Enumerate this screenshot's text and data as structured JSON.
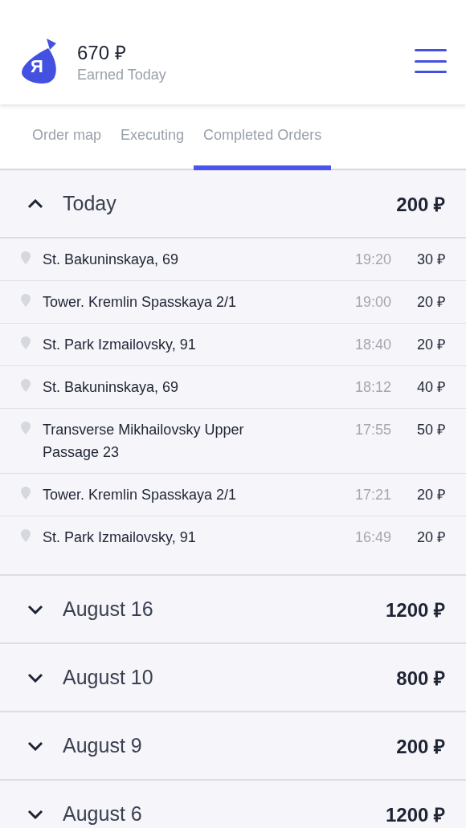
{
  "header": {
    "logo_letter": "Я",
    "amount": "670 ₽",
    "caption": "Earned Today"
  },
  "tabs": [
    {
      "label": "Order map",
      "selected": false
    },
    {
      "label": "Executing",
      "selected": false
    },
    {
      "label": "Completed Orders",
      "selected": true
    }
  ],
  "groups": [
    {
      "title": "Today",
      "total": "200 ₽",
      "expanded": true,
      "orders": [
        {
          "address": "St. Bakuninskaya, 69",
          "time": "19:20",
          "price": "30 ₽"
        },
        {
          "address": "Tower. Kremlin Spasskaya 2/1",
          "time": "19:00",
          "price": "20 ₽"
        },
        {
          "address": "St. Park Izmailovsky, 91",
          "time": "18:40",
          "price": "20 ₽"
        },
        {
          "address": "St. Bakuninskaya, 69",
          "time": "18:12",
          "price": "40 ₽"
        },
        {
          "address": "Transverse Mikhailovsky Upper Passage 23",
          "time": "17:55",
          "price": "50 ₽"
        },
        {
          "address": "Tower. Kremlin Spasskaya 2/1",
          "time": "17:21",
          "price": "20 ₽"
        },
        {
          "address": "St. Park Izmailovsky, 91",
          "time": "16:49",
          "price": "20 ₽"
        }
      ]
    },
    {
      "title": "August 16",
      "total": "1200 ₽",
      "expanded": false
    },
    {
      "title": "August 10",
      "total": "800 ₽",
      "expanded": false
    },
    {
      "title": "August 9",
      "total": "200 ₽",
      "expanded": false
    },
    {
      "title": "August 6",
      "total": "1200 ₽",
      "expanded": false
    }
  ]
}
